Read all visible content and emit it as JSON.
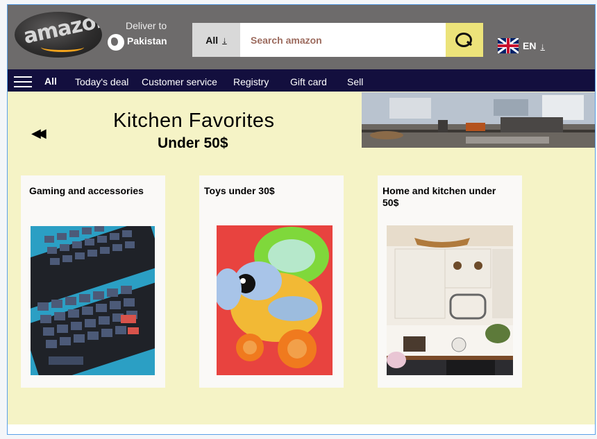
{
  "header": {
    "logo_text": "amazon",
    "deliver_label": "Deliver to",
    "deliver_country": "Pakistan",
    "search_category": "All",
    "search_placeholder": "Search amazon",
    "language": "EN"
  },
  "nav": {
    "all_label": "All",
    "items": [
      "Today's deal",
      "Customer service",
      "Registry",
      "Gift card",
      "Sell"
    ]
  },
  "banner": {
    "title": "Kitchen  Favorites",
    "subtitle": "Under 50$"
  },
  "cards": [
    {
      "title": "Gaming and accessories"
    },
    {
      "title": "Toys under 30$"
    },
    {
      "title": "Home and kitchen under 50$"
    }
  ],
  "colors": {
    "topbar": "#6d6b6b",
    "navbar": "#130f3e",
    "content_bg": "#f5f3c6",
    "search_button": "#ece37a",
    "logo_smile": "#f2a31c"
  },
  "icons": [
    "globe-icon",
    "download-icon",
    "search-icon",
    "uk-flag-icon",
    "hamburger-icon",
    "rewind-icon"
  ]
}
